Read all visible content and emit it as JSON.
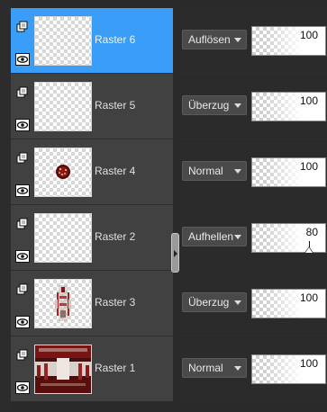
{
  "layers": [
    {
      "name": "Raster 6",
      "blend": "Auflösen",
      "opacity": 100,
      "selected": true,
      "thumb": "empty",
      "show_marker": false
    },
    {
      "name": "Raster 5",
      "blend": "Überzug",
      "opacity": 100,
      "selected": false,
      "thumb": "empty",
      "show_marker": false
    },
    {
      "name": "Raster 4",
      "blend": "Normal",
      "opacity": 100,
      "selected": false,
      "thumb": "sphere",
      "show_marker": false
    },
    {
      "name": "Raster 2",
      "blend": "Aufhellen",
      "opacity": 80,
      "selected": false,
      "thumb": "empty",
      "show_marker": true
    },
    {
      "name": "Raster 3",
      "blend": "Überzug",
      "opacity": 100,
      "selected": false,
      "thumb": "figure",
      "show_marker": false
    },
    {
      "name": "Raster 1",
      "blend": "Normal",
      "opacity": 100,
      "selected": false,
      "thumb": "photo",
      "show_marker": false
    }
  ],
  "icons": {
    "group": "layer-group-icon",
    "visibility": "eye-icon",
    "splitter": "panel-splitter-arrow-icon"
  },
  "colors": {
    "selected_row": "#3a9ef9",
    "row_bg": "#414141",
    "panel_bg": "#2a2a2a",
    "select_bg": "#4a4a4a"
  }
}
